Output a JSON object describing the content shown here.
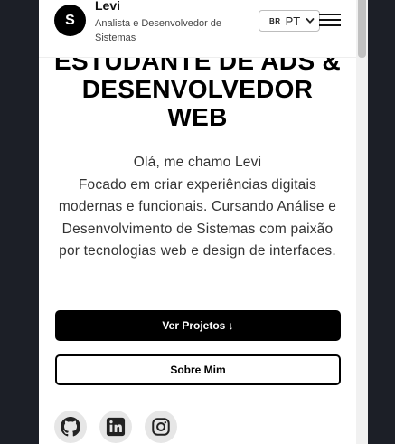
{
  "header": {
    "logo_letter": "S",
    "brand_name": "Levi",
    "brand_subtitle": "Analista e Desenvolvedor de Sistemas",
    "language": {
      "flag": "BR",
      "selected": "PT"
    }
  },
  "hero": {
    "title_lines": [
      "ESTUDANTE DE ADS &",
      "DESENVOLVEDOR",
      "WEB"
    ],
    "greeting": "Olá, me chamo Levi",
    "description": "Focado em criar experiências digitais modernas e funcionais. Cursando Análise e Desenvolvimento de Sistemas com paixão por tecnologias web e design de interfaces."
  },
  "actions": {
    "primary_label": "Ver Projetos ↓",
    "secondary_label": "Sobre Mim"
  },
  "socials": [
    {
      "icon": "github-icon"
    },
    {
      "icon": "linkedin-icon"
    },
    {
      "icon": "instagram-icon"
    }
  ],
  "colors": {
    "background": "#1c1f27",
    "page": "#ffffff",
    "primary": "#000000",
    "social_bg": "#e6e6e6"
  }
}
